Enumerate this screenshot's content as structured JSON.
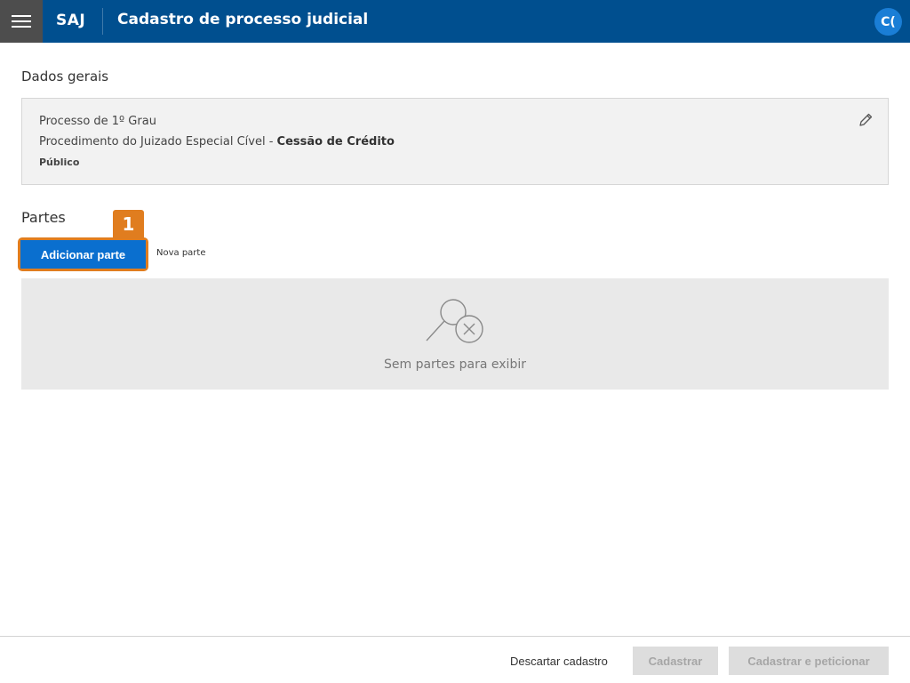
{
  "header": {
    "brand": "SAJ",
    "title": "Cadastro de processo judicial",
    "avatar_initials": "C("
  },
  "dados_gerais": {
    "title": "Dados gerais",
    "line1": "Processo de 1º Grau",
    "line2_prefix": "Procedimento do Juizado Especial Cível - ",
    "line2_bold": "Cessão de Crédito",
    "line3": "Público"
  },
  "partes": {
    "title": "Partes",
    "step_badge": "1",
    "add_button": "Adicionar parte",
    "add_hint": "Nova parte",
    "empty_message": "Sem partes para exibir"
  },
  "footer": {
    "discard": "Descartar cadastro",
    "register": "Cadastrar",
    "register_and_petition": "Cadastrar e peticionar"
  },
  "colors": {
    "topbar": "#004f8f",
    "menu_button": "#4d4d4d",
    "primary_button": "#0a6fcf",
    "highlight": "#e07d1f",
    "disabled_button": "#dddddd"
  },
  "icons": {
    "menu": "hamburger-menu-icon",
    "edit": "pencil-icon",
    "empty": "search-no-results-icon"
  }
}
